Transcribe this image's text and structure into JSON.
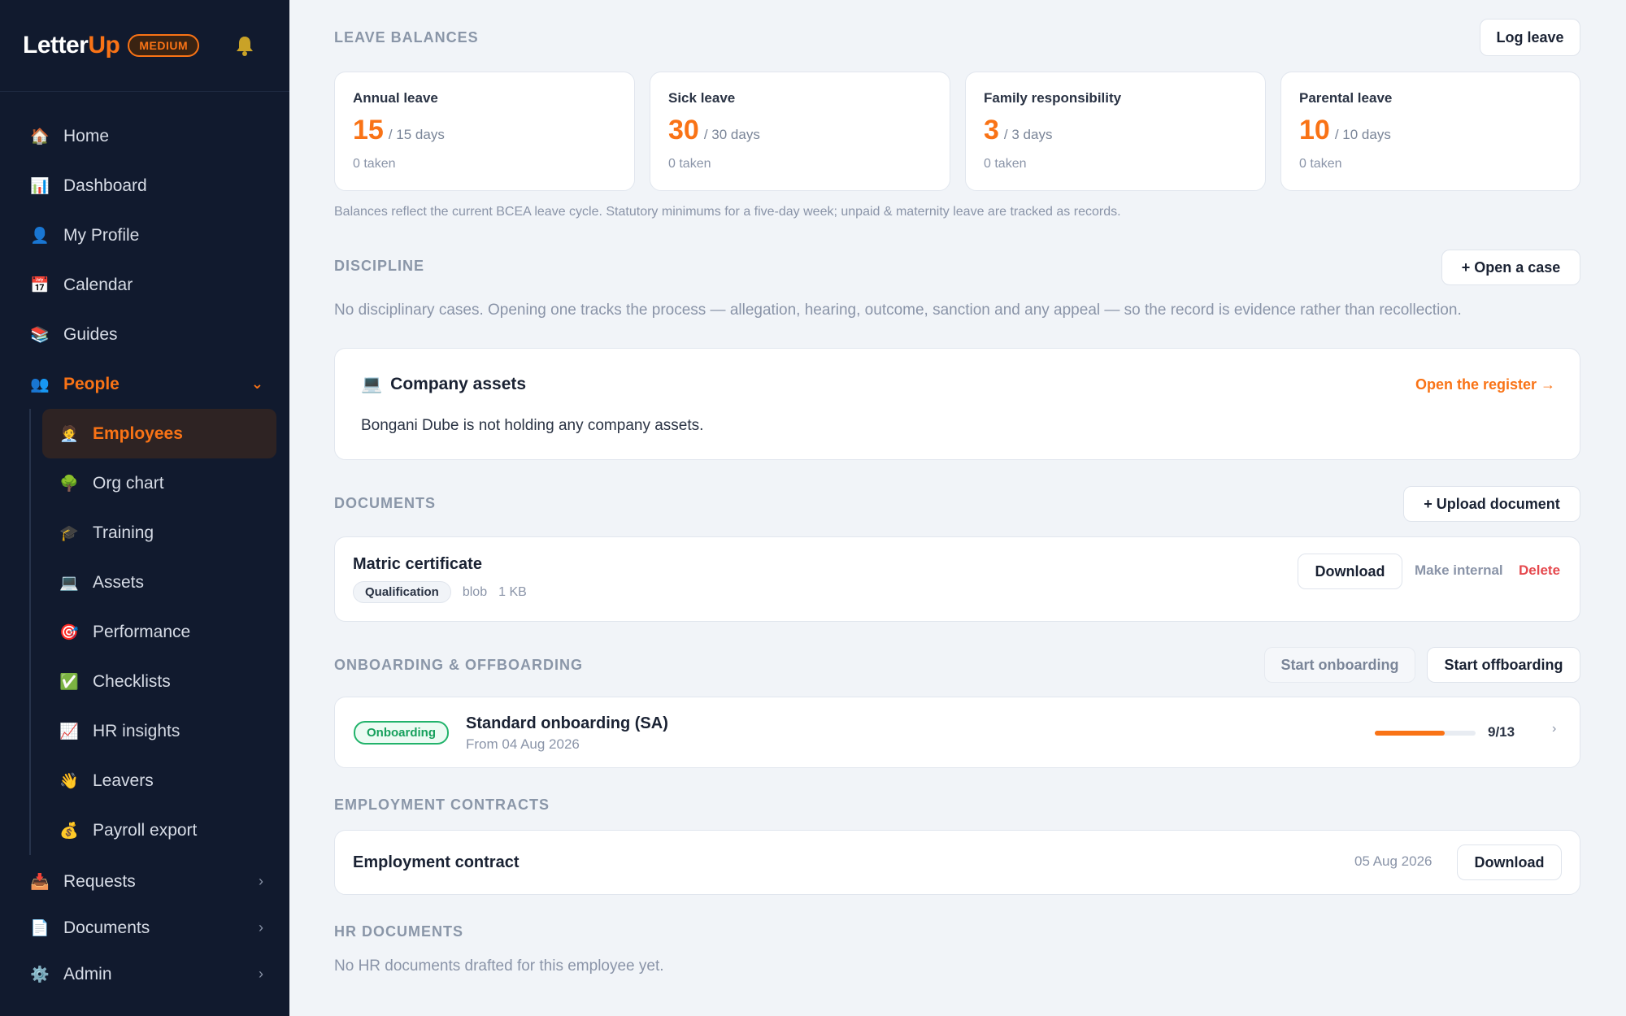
{
  "sidebar": {
    "logo_main": "Letter",
    "logo_accent": "Up",
    "tier": "MEDIUM",
    "items": [
      {
        "label": "Home",
        "icon": "🏠"
      },
      {
        "label": "Dashboard",
        "icon": "📊"
      },
      {
        "label": "My Profile",
        "icon": "👤"
      },
      {
        "label": "Calendar",
        "icon": "📅"
      },
      {
        "label": "Guides",
        "icon": "📚"
      },
      {
        "label": "People",
        "icon": "👥"
      }
    ],
    "people_sub": [
      {
        "label": "Employees",
        "icon": "🧑‍💼"
      },
      {
        "label": "Org chart",
        "icon": "🌳"
      },
      {
        "label": "Training",
        "icon": "🎓"
      },
      {
        "label": "Assets",
        "icon": "💻"
      },
      {
        "label": "Performance",
        "icon": "🎯"
      },
      {
        "label": "Checklists",
        "icon": "✅"
      },
      {
        "label": "HR insights",
        "icon": "📈"
      },
      {
        "label": "Leavers",
        "icon": "👋"
      },
      {
        "label": "Payroll export",
        "icon": "💰"
      }
    ],
    "bottom": [
      {
        "label": "Requests",
        "icon": "📥"
      },
      {
        "label": "Documents",
        "icon": "📄"
      },
      {
        "label": "Admin",
        "icon": "⚙️"
      }
    ]
  },
  "leave": {
    "title": "LEAVE BALANCES",
    "log_button": "Log leave",
    "cards": [
      {
        "name": "Annual leave",
        "value": "15",
        "of": "/ 15 days",
        "taken": "0 taken"
      },
      {
        "name": "Sick leave",
        "value": "30",
        "of": "/ 30 days",
        "taken": "0 taken"
      },
      {
        "name": "Family responsibility",
        "value": "3",
        "of": "/ 3 days",
        "taken": "0 taken"
      },
      {
        "name": "Parental leave",
        "value": "10",
        "of": "/ 10 days",
        "taken": "0 taken"
      }
    ],
    "note": "Balances reflect the current BCEA leave cycle. Statutory minimums for a five-day week; unpaid & maternity leave are tracked as records."
  },
  "discipline": {
    "title": "DISCIPLINE",
    "open_button": "+ Open a case",
    "text": "No disciplinary cases. Opening one tracks the process — allegation, hearing, outcome, sanction and any appeal — so the record is evidence rather than recollection."
  },
  "assets": {
    "icon": "💻",
    "title": "Company assets",
    "link": "Open the register →",
    "text": "Bongani Dube is not holding any company assets."
  },
  "documents": {
    "title": "DOCUMENTS",
    "upload_button": "+ Upload document",
    "item_name": "Matric certificate",
    "tag": "Qualification",
    "type": "blob",
    "size": "1 KB",
    "download": "Download",
    "make_internal": "Make internal",
    "delete": "Delete"
  },
  "onboarding": {
    "title": "ONBOARDING & OFFBOARDING",
    "start_onboarding": "Start onboarding",
    "start_offboarding": "Start offboarding",
    "status": "Onboarding",
    "name": "Standard onboarding (SA)",
    "from": "From 04 Aug 2026",
    "progress_label": "9/13",
    "progress_done": 9,
    "progress_total": 13,
    "chevron": "›"
  },
  "contracts": {
    "title": "EMPLOYMENT CONTRACTS",
    "name": "Employment contract",
    "date": "05 Aug 2026",
    "download": "Download"
  },
  "hr_docs": {
    "title": "HR DOCUMENTS",
    "text": "No HR documents drafted for this employee yet."
  },
  "colors": {
    "accent": "#f97316",
    "sidebar_bg": "#111a2e",
    "danger": "#e5484d",
    "success": "#22b36b"
  }
}
